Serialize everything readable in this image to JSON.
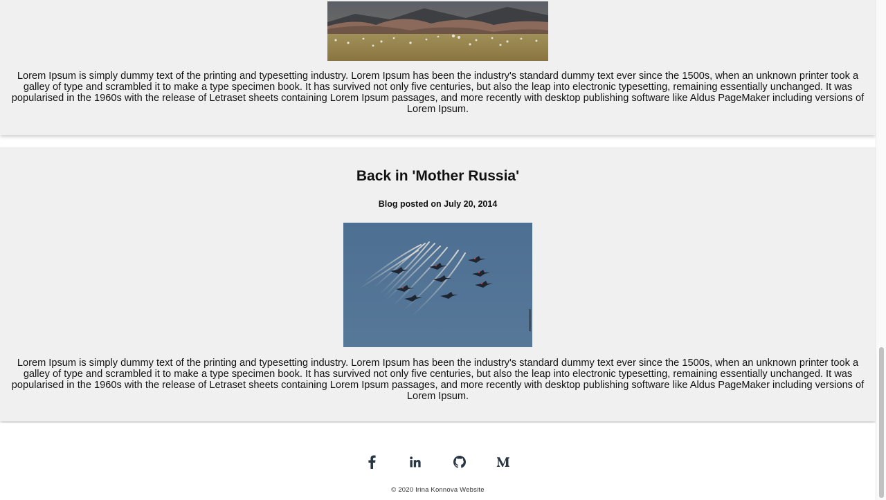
{
  "posts": [
    {
      "image_alt": "sheep grazing in a field",
      "body": "Lorem Ipsum is simply dummy text of the printing and typesetting industry. Lorem Ipsum has been the industry's standard dummy text ever since the 1500s, when an unknown printer took a galley of type and scrambled it to make a type specimen book. It has survived not only five centuries, but also the leap into electronic typesetting, remaining essentially unchanged. It was popularised in the 1960s with the release of Letraset sheets containing Lorem Ipsum passages, and more recently with desktop publishing software like Aldus PageMaker including versions of Lorem Ipsum."
    },
    {
      "title": "Back in 'Mother Russia'",
      "date": "Blog posted on July 20, 2014",
      "image_alt": "aircraft formation releasing flares",
      "body": "Lorem Ipsum is simply dummy text of the printing and typesetting industry. Lorem Ipsum has been the industry's standard dummy text ever since the 1500s, when an unknown printer took a galley of type and scrambled it to make a type specimen book. It has survived not only five centuries, but also the leap into electronic typesetting, remaining essentially unchanged. It was popularised in the 1960s with the release of Letraset sheets containing Lorem Ipsum passages, and more recently with desktop publishing software like Aldus PageMaker including versions of Lorem Ipsum."
    }
  ],
  "footer": {
    "social_icons": [
      "facebook-icon",
      "linkedin-icon",
      "github-icon",
      "medium-icon"
    ],
    "copyright": "© 2020 Irina Konnova Website"
  },
  "colors": {
    "card_background": "#f0f0f0",
    "icon": "#2b3645",
    "text": "#111111"
  }
}
